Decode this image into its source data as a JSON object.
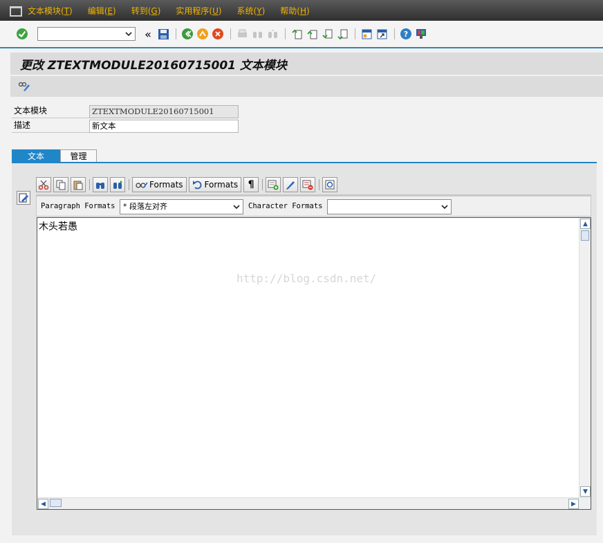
{
  "menu": {
    "items": [
      {
        "label": "文本模块(",
        "key": "T",
        "tail": ")"
      },
      {
        "label": "编辑(",
        "key": "E",
        "tail": ")"
      },
      {
        "label": "转到(",
        "key": "G",
        "tail": ")"
      },
      {
        "label": "实用程序(",
        "key": "U",
        "tail": ")"
      },
      {
        "label": "系统(",
        "key": "Y",
        "tail": ")"
      },
      {
        "label": "帮助(",
        "key": "H",
        "tail": ")"
      }
    ]
  },
  "toolbar": {
    "command_value": "",
    "history_glyph": "«"
  },
  "title": "更改 ZTEXTMODULE20160715001 文本模块",
  "fields": {
    "text_module_label": "文本模块",
    "text_module_value": "ZTEXTMODULE20160715001",
    "description_label": "描述",
    "description_value": "新文本"
  },
  "tabs": [
    {
      "label": "文本",
      "active": true
    },
    {
      "label": "管理",
      "active": false
    }
  ],
  "editor_toolbar": {
    "formats_button_1": "Formats",
    "formats_button_2": "Formats",
    "pilcrow": "¶"
  },
  "format_bar": {
    "paragraph_label": "Paragraph Formats",
    "paragraph_value": "* 段落左对齐",
    "character_label": "Character Formats",
    "character_value": ""
  },
  "editor": {
    "content": "木头若愚",
    "watermark": "http://blog.csdn.net/"
  },
  "colors": {
    "menu_text": "#f0b400",
    "accent_blue": "#1f86c8"
  }
}
